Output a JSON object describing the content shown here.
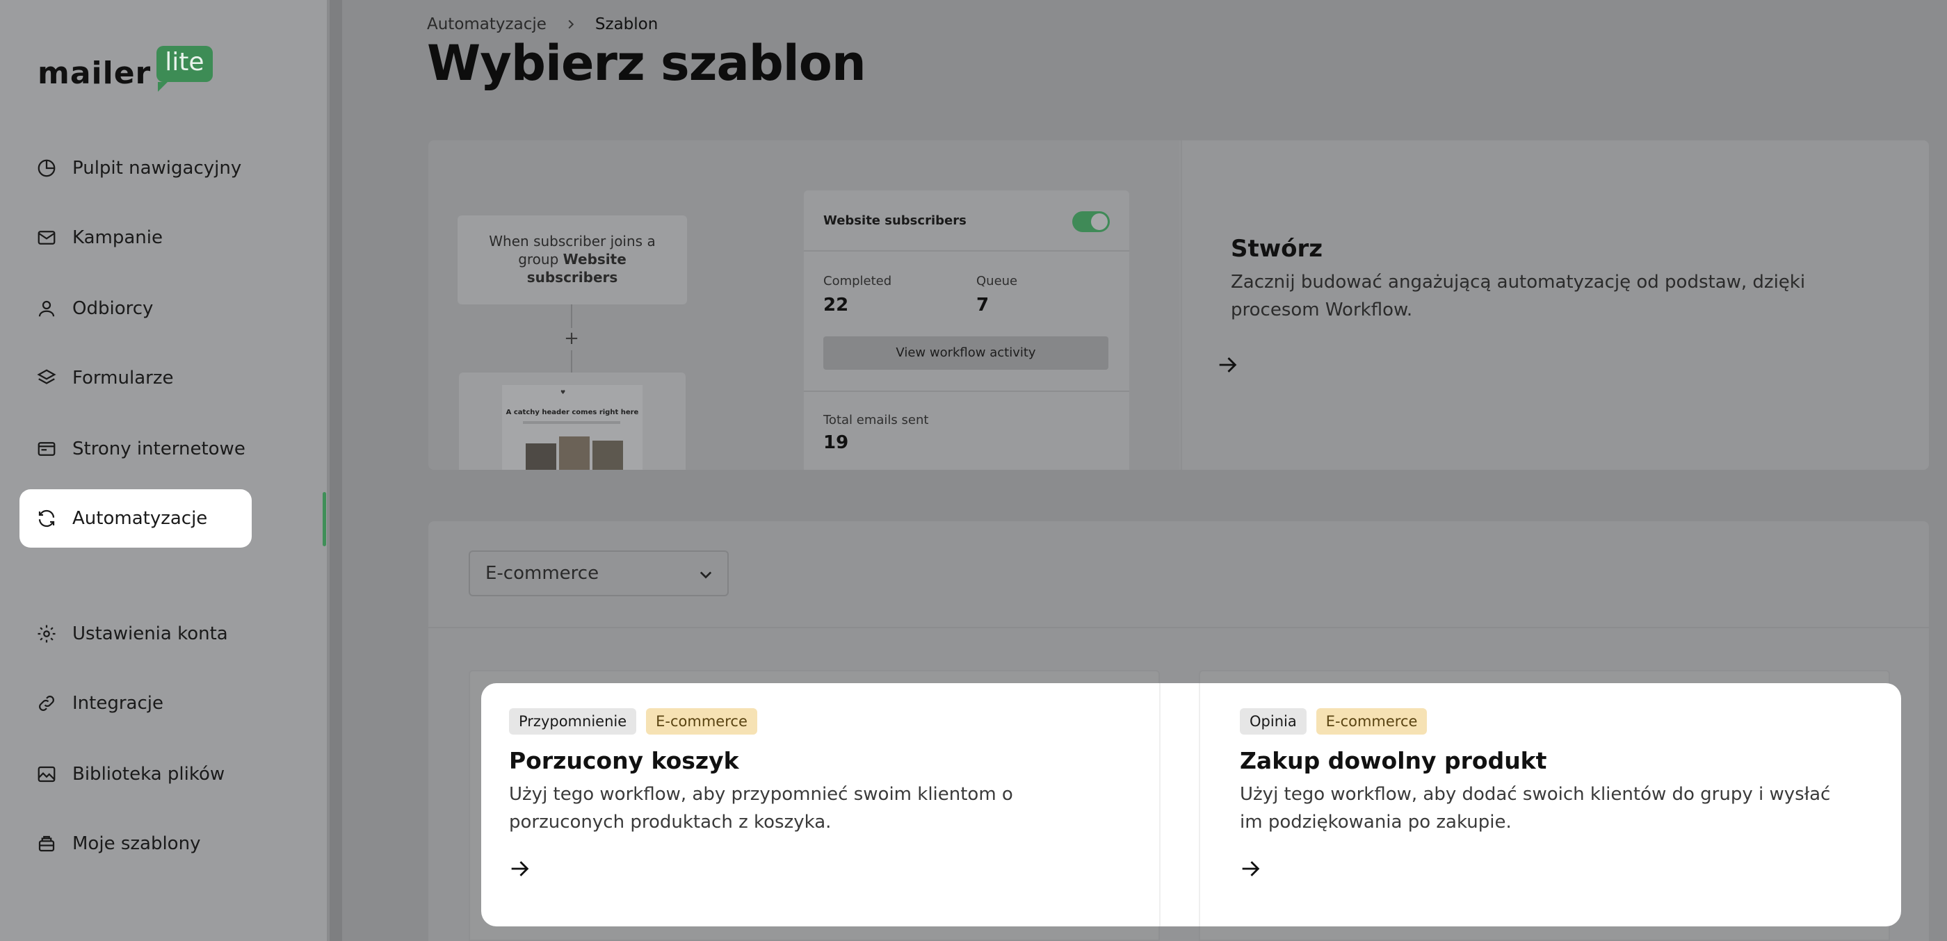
{
  "logo": {
    "word": "mailer",
    "badge": "lite"
  },
  "sidebar": {
    "items": [
      {
        "label": "Pulpit nawigacyjny",
        "icon": "dashboard-icon"
      },
      {
        "label": "Kampanie",
        "icon": "mail-icon"
      },
      {
        "label": "Odbiorcy",
        "icon": "user-icon"
      },
      {
        "label": "Formularze",
        "icon": "layers-icon"
      },
      {
        "label": "Strony internetowe",
        "icon": "website-icon"
      },
      {
        "label": "Automatyzacje",
        "icon": "refresh-icon",
        "active": true
      },
      {
        "label": "Ustawienia konta",
        "icon": "gear-icon"
      },
      {
        "label": "Integracje",
        "icon": "link-icon"
      },
      {
        "label": "Biblioteka plików",
        "icon": "image-icon"
      },
      {
        "label": "Moje szablony",
        "icon": "template-icon"
      }
    ]
  },
  "breadcrumb": {
    "parent": "Automatyzacje",
    "current": "Szablon"
  },
  "page": {
    "title": "Wybierz szablon"
  },
  "preview": {
    "trigger_prefix": "When subscriber joins a group",
    "trigger_group": "Website subscribers",
    "plus": "+",
    "email_header": "A catchy header comes right here",
    "stats": {
      "title": "Website subscribers",
      "completed_label": "Completed",
      "completed_value": "22",
      "queue_label": "Queue",
      "queue_value": "7",
      "button": "View workflow activity",
      "total_label": "Total emails sent",
      "total_value": "19"
    }
  },
  "create": {
    "title": "Stwórz",
    "description": "Zacznij budować angażującą automatyzację od podstaw, dzięki procesom Workflow."
  },
  "filter": {
    "selected": "E-commerce"
  },
  "templates": [
    {
      "tags": [
        "Przypomnienie",
        "E-commerce"
      ],
      "title": "Porzucony koszyk",
      "description": "Użyj tego workflow, aby przypomnieć swoim klientom o porzuconych produktach z koszyka."
    },
    {
      "tags": [
        "Opinia",
        "E-commerce"
      ],
      "title": "Zakup dowolny produkt",
      "description": "Użyj tego workflow, aby dodać swoich klientów do grupy i wysłać im podziękowania po zakupie."
    }
  ],
  "colors": {
    "brand": "#3d8c55",
    "tag_yellow": "#f6e2b4",
    "tag_grey": "#e6e6e6"
  }
}
